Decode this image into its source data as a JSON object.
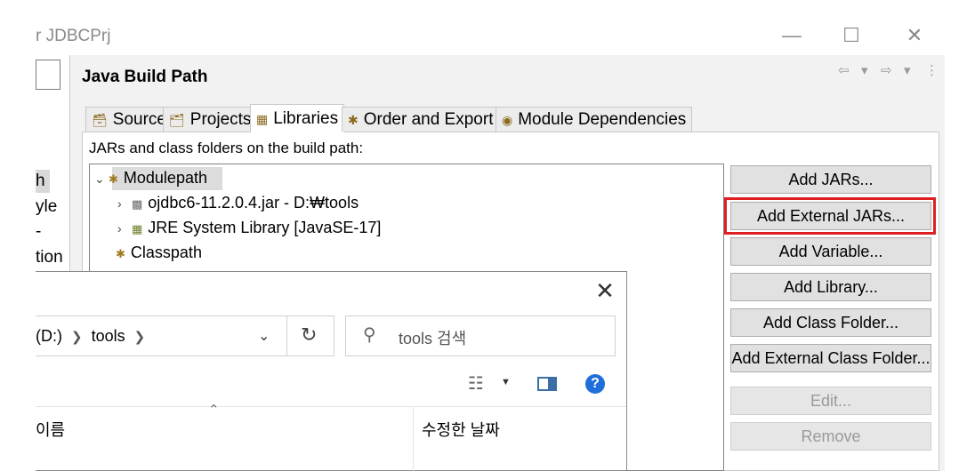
{
  "window": {
    "title": "r JDBCPrj",
    "controls": [
      "—",
      "☐",
      "✕"
    ]
  },
  "left_nav": {
    "items": [
      "h",
      "yle",
      "-",
      "tion"
    ]
  },
  "page": {
    "title": "Java Build Path",
    "nav": [
      "⇦",
      "▾",
      "⇨",
      "▾",
      "⋮"
    ]
  },
  "tabs": [
    {
      "label": "Source",
      "icon": "source-folder-icon"
    },
    {
      "label": "Projects",
      "icon": "projects-icon"
    },
    {
      "label": "Libraries",
      "icon": "libraries-icon",
      "active": true
    },
    {
      "label": "Order and Export",
      "icon": "order-export-icon"
    },
    {
      "label": "Module Dependencies",
      "icon": "module-icon"
    }
  ],
  "libraries": {
    "description": "JARs and class folders on the build path:",
    "tree": [
      {
        "label": "Modulepath",
        "expanded": true,
        "selected": true
      },
      {
        "label": "ojdbc6-11.2.0.4.jar - D:₩tools"
      },
      {
        "label": "JRE System Library [JavaSE-17]"
      },
      {
        "label": "Classpath"
      }
    ],
    "buttons": [
      {
        "label": "Add JARs...",
        "enabled": true
      },
      {
        "label": "Add External JARs...",
        "enabled": true,
        "highlighted": true
      },
      {
        "label": "Add Variable...",
        "enabled": true
      },
      {
        "label": "Add Library...",
        "enabled": true
      },
      {
        "label": "Add Class Folder...",
        "enabled": true
      },
      {
        "label": "Add External Class Folder...",
        "enabled": true
      },
      {
        "label": "Edit...",
        "enabled": false
      },
      {
        "label": "Remove",
        "enabled": false
      }
    ]
  },
  "file_dialog": {
    "close": "✕",
    "breadcrumb": [
      "(D:)",
      "tools"
    ],
    "search_placeholder": "tools 검색",
    "columns": [
      "이름",
      "수정한 날짜"
    ]
  },
  "colors": {
    "highlight": "#e02020",
    "help": "#1e6fd9",
    "selected_row": "#dcdcdc"
  }
}
